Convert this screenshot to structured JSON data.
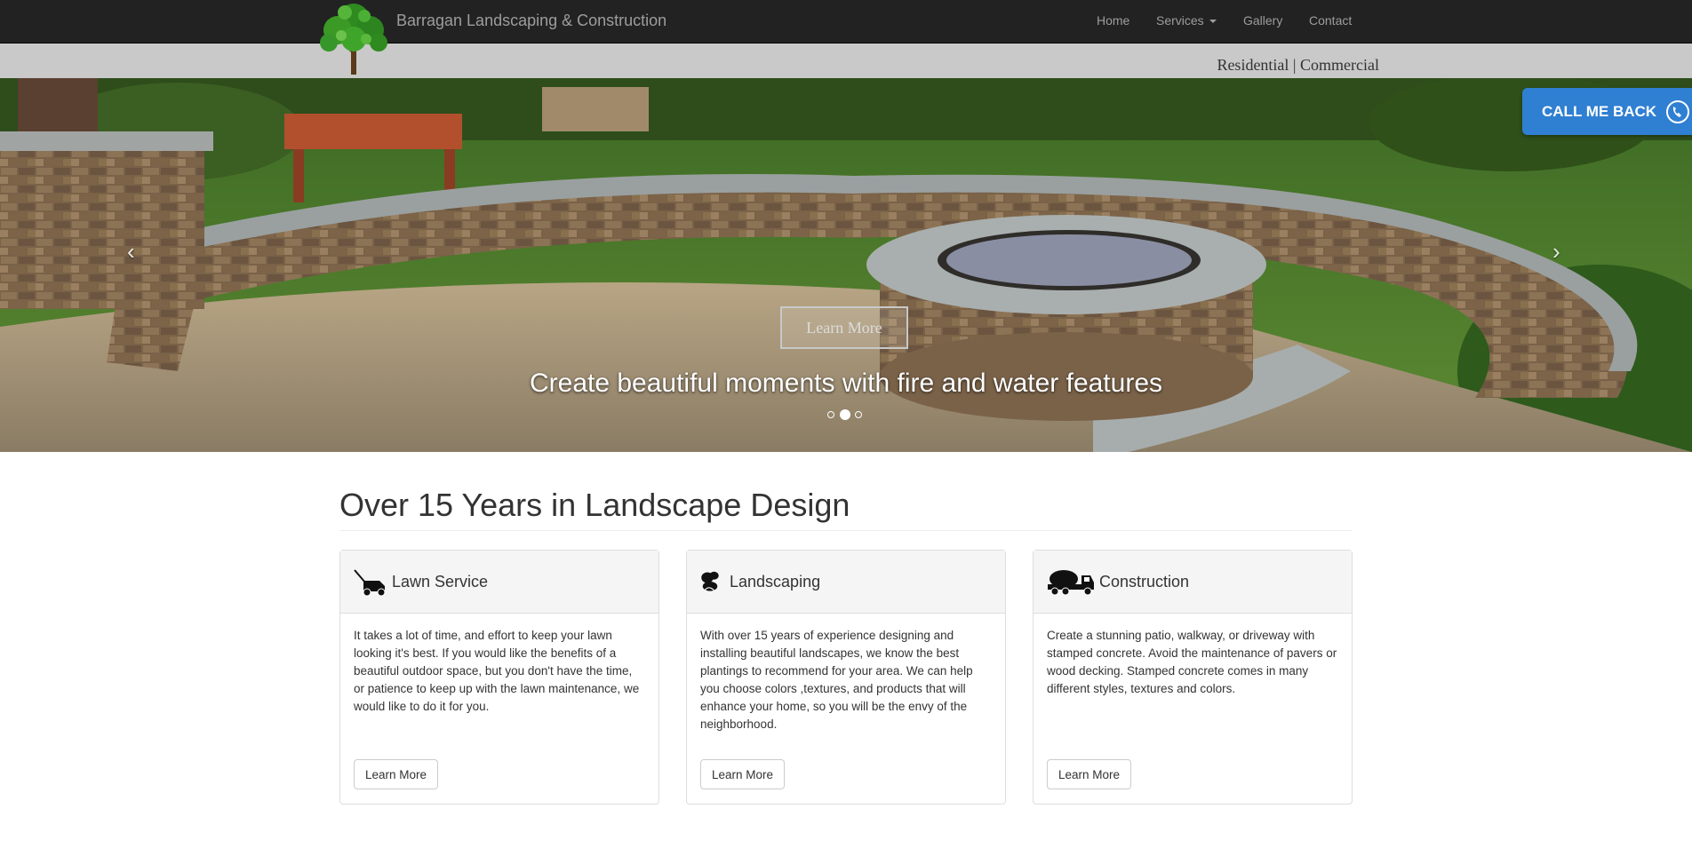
{
  "navbar": {
    "brand": "Barragan Landscaping & Construction",
    "items": [
      {
        "label": "Home"
      },
      {
        "label": "Services"
      },
      {
        "label": "Gallery"
      },
      {
        "label": "Contact"
      }
    ]
  },
  "subbar": {
    "tagline": "Residential | Commercial"
  },
  "hero": {
    "button": "Learn More",
    "caption": "Create beautiful moments with fire and water features",
    "prev": "‹",
    "next": "›",
    "active_slide": 2,
    "slide_count": 3
  },
  "callback": {
    "label": "CALL ME BACK"
  },
  "main": {
    "title": "Over 15 Years in Landscape Design",
    "panels": [
      {
        "title": "Lawn Service",
        "icon": "lawn-mower-icon",
        "text": "It takes a lot of time, and effort to keep your lawn looking it's best. If you would like the benefits of a beautiful outdoor space, but you don't have the time, or patience to keep up with the lawn maintenance, we would like to do it for you.",
        "button": "Learn More"
      },
      {
        "title": "Landscaping",
        "icon": "landscaping-icon",
        "text": "With over 15 years of experience designing and installing beautiful landscapes, we know the best plantings to recommend for your area. We can help you choose colors ,textures, and products that will enhance your home, so you will be the envy of the neighborhood.",
        "button": "Learn More"
      },
      {
        "title": "Construction",
        "icon": "cement-truck-icon",
        "text": "Create a stunning patio, walkway, or driveway with stamped concrete. Avoid the maintenance of pavers or wood decking. Stamped concrete comes in many different styles, textures and colors.",
        "button": "Learn More"
      }
    ]
  },
  "colors": {
    "navbar": "#222222",
    "subbar": "#c9c9c9",
    "callback": "#2f7fd2"
  }
}
